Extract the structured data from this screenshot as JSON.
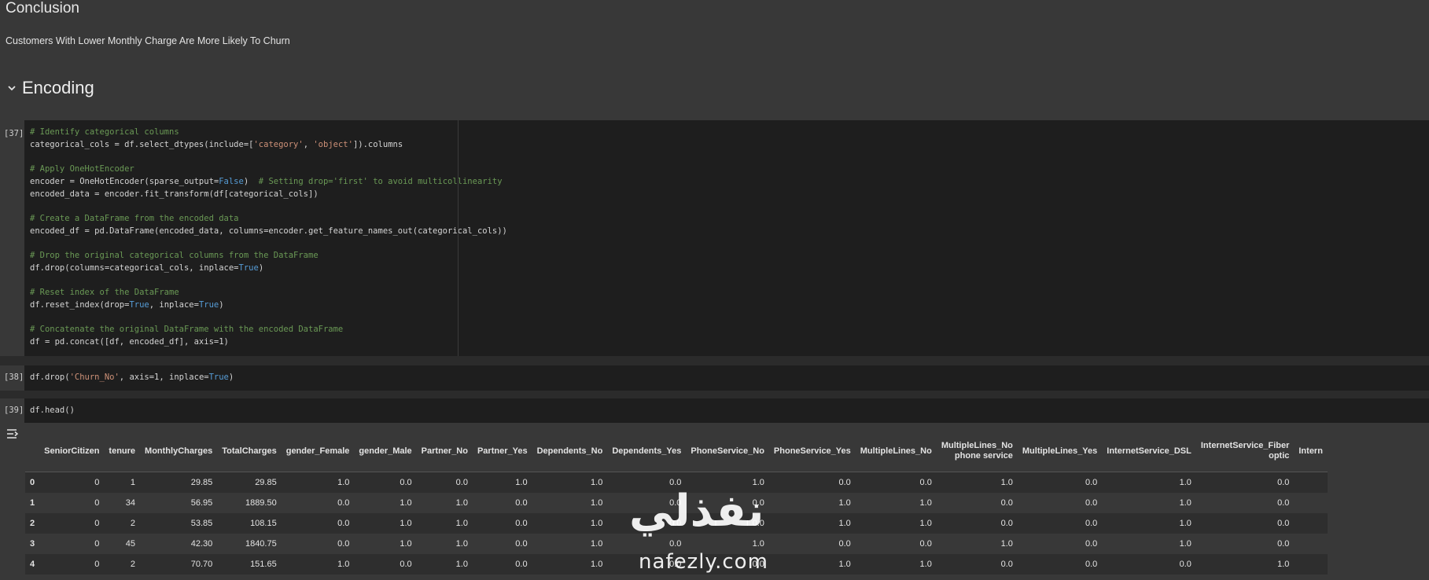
{
  "markdown": {
    "heading": "Conclusion",
    "text": "Customers With Lower Monthly Charge Are More Likely To Churn",
    "section_title": "Encoding"
  },
  "cells": [
    {
      "exec": "[37]"
    },
    {
      "exec": "[38]",
      "code": "df.drop('Churn_No', axis=1, inplace=True)"
    },
    {
      "exec": "[39]",
      "code": "df.head()"
    }
  ],
  "code37": {
    "l1": "# Identify categorical columns",
    "l2a": "categorical_cols = df.select_dtypes(include=[",
    "l2b": "'category'",
    "l2c": ", ",
    "l2d": "'object'",
    "l2e": "]).columns",
    "l4": "# Apply OneHotEncoder",
    "l5a": "encoder = OneHotEncoder(sparse_output=",
    "l5b": "False",
    "l5c": ")  ",
    "l5d": "# Setting drop='first' to avoid multicollinearity",
    "l6": "encoded_data = encoder.fit_transform(df[categorical_cols])",
    "l8": "# Create a DataFrame from the encoded data",
    "l9": "encoded_df = pd.DataFrame(encoded_data, columns=encoder.get_feature_names_out(categorical_cols))",
    "l11": "# Drop the original categorical columns from the DataFrame",
    "l12a": "df.drop(columns=categorical_cols, inplace=",
    "l12b": "True",
    "l12c": ")",
    "l14": "# Reset index of the DataFrame",
    "l15a": "df.reset_index(drop=",
    "l15b": "True",
    "l15c": ", inplace=",
    "l15d": "True",
    "l15e": ")",
    "l17": "# Concatenate the original DataFrame with the encoded DataFrame",
    "l18": "df = pd.concat([df, encoded_df], axis=1)"
  },
  "code38": {
    "a": "df.drop(",
    "b": "'Churn_No'",
    "c": ", axis=1, inplace=",
    "d": "True",
    "e": ")"
  },
  "table": {
    "columns": [
      "",
      "SeniorCitizen",
      "tenure",
      "MonthlyCharges",
      "TotalCharges",
      "gender_Female",
      "gender_Male",
      "Partner_No",
      "Partner_Yes",
      "Dependents_No",
      "Dependents_Yes",
      "PhoneService_No",
      "PhoneService_Yes",
      "MultipleLines_No",
      "MultipleLines_No\nphone service",
      "MultipleLines_Yes",
      "InternetService_DSL",
      "InternetService_Fiber\noptic",
      "Intern"
    ],
    "rows": [
      [
        "0",
        "0",
        "1",
        "29.85",
        "29.85",
        "1.0",
        "0.0",
        "0.0",
        "1.0",
        "1.0",
        "0.0",
        "1.0",
        "0.0",
        "0.0",
        "1.0",
        "0.0",
        "1.0",
        "0.0",
        ""
      ],
      [
        "1",
        "0",
        "34",
        "56.95",
        "1889.50",
        "0.0",
        "1.0",
        "1.0",
        "0.0",
        "1.0",
        "0.0",
        "0.0",
        "1.0",
        "1.0",
        "0.0",
        "0.0",
        "1.0",
        "0.0",
        ""
      ],
      [
        "2",
        "0",
        "2",
        "53.85",
        "108.15",
        "0.0",
        "1.0",
        "1.0",
        "0.0",
        "1.0",
        "0.0",
        "0.0",
        "1.0",
        "1.0",
        "0.0",
        "0.0",
        "1.0",
        "0.0",
        ""
      ],
      [
        "3",
        "0",
        "45",
        "42.30",
        "1840.75",
        "0.0",
        "1.0",
        "1.0",
        "0.0",
        "1.0",
        "0.0",
        "1.0",
        "0.0",
        "0.0",
        "1.0",
        "0.0",
        "1.0",
        "0.0",
        ""
      ],
      [
        "4",
        "0",
        "2",
        "70.70",
        "151.65",
        "1.0",
        "0.0",
        "1.0",
        "0.0",
        "1.0",
        "0.0",
        "0.0",
        "1.0",
        "1.0",
        "0.0",
        "0.0",
        "0.0",
        "1.0",
        ""
      ]
    ]
  },
  "watermark": {
    "arabic": "نفذلي",
    "latin": "nafezly.com"
  }
}
